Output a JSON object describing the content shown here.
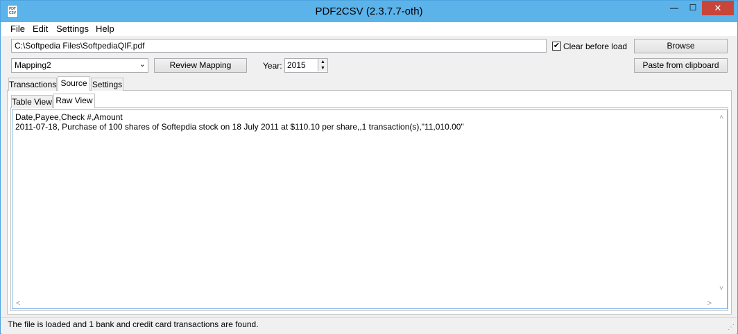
{
  "window": {
    "title": "PDF2CSV (2.3.7.7-oth)",
    "icon_text": "PDF\nCSV",
    "minimize_glyph": "—",
    "maximize_glyph": "☐",
    "close_glyph": "✕"
  },
  "menu": {
    "items": [
      "File",
      "Edit",
      "Settings",
      "Help"
    ]
  },
  "toolbar": {
    "file_path": "C:\\Softpedia Files\\SoftpediaQIF.pdf",
    "clear_before_load_label": "Clear before load",
    "clear_before_load_checked": true,
    "check_glyph": "✔",
    "browse_label": "Browse",
    "paste_label": "Paste from clipboard",
    "mapping_value": "Mapping2",
    "dropdown_glyph": "⌄",
    "review_label": "Review Mapping",
    "year_label": "Year:",
    "year_value": "2015",
    "spin_up_glyph": "▲",
    "spin_down_glyph": "▼"
  },
  "tabs": {
    "main": [
      "Transactions",
      "Source",
      "Settings"
    ],
    "main_active": "Source",
    "sub": [
      "Table View",
      "Raw View"
    ],
    "sub_active": "Raw View"
  },
  "raw_view": {
    "lines": [
      "Date,Payee,Check #,Amount",
      "2011-07-18, Purchase of 100 shares of Softepdia stock on 18 July 2011 at $110.10 per share,,1 transaction(s),\"11,010.00\""
    ],
    "scroll_up_glyph": "˄",
    "scroll_down_glyph": "˅",
    "scroll_left_glyph": "<",
    "scroll_right_glyph": ">"
  },
  "status": {
    "text": "The file is loaded and 1 bank and credit card transactions are found.",
    "grip_glyph": "⋰"
  }
}
